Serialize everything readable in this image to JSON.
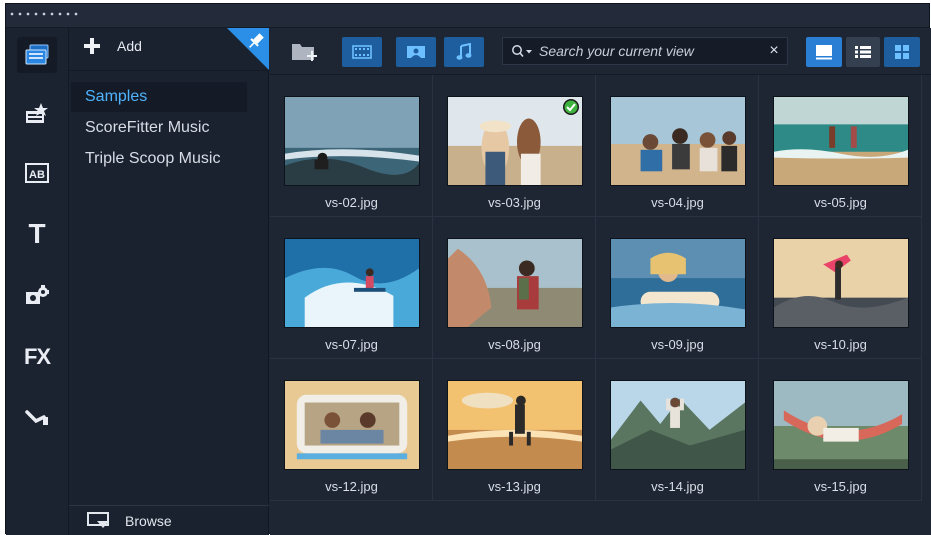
{
  "library": {
    "add_label": "Add",
    "folders": [
      "Samples",
      "ScoreFitter Music",
      "Triple Scoop Music"
    ],
    "selected_folder": "Samples",
    "browse_label": "Browse"
  },
  "rail": {
    "items": [
      "media-library",
      "instant-project",
      "title-templates",
      "titles",
      "graphics",
      "filters",
      "transitions"
    ],
    "ab_label": "AB",
    "t_label": "T",
    "fx_label": "FX"
  },
  "toolbar": {
    "search_placeholder": "Search your current view",
    "clear_label": "×",
    "media_type_buttons": [
      "show-videos",
      "show-photos",
      "show-audio"
    ],
    "view_buttons": [
      "thumbnail-view",
      "list-view",
      "grid-view"
    ]
  },
  "media": [
    {
      "file": "vs-02.jpg",
      "checked": false
    },
    {
      "file": "vs-03.jpg",
      "checked": true
    },
    {
      "file": "vs-04.jpg",
      "checked": false
    },
    {
      "file": "vs-05.jpg",
      "checked": false
    },
    {
      "file": "vs-07.jpg",
      "checked": false
    },
    {
      "file": "vs-08.jpg",
      "checked": false
    },
    {
      "file": "vs-09.jpg",
      "checked": false
    },
    {
      "file": "vs-10.jpg",
      "checked": false
    },
    {
      "file": "vs-12.jpg",
      "checked": false
    },
    {
      "file": "vs-13.jpg",
      "checked": false
    },
    {
      "file": "vs-14.jpg",
      "checked": false
    },
    {
      "file": "vs-15.jpg",
      "checked": false
    }
  ],
  "colors": {
    "accent": "#2a7fd4",
    "selected_text": "#4fb3ff",
    "panel_bg": "#1e2634",
    "check": "#3fb33f"
  }
}
